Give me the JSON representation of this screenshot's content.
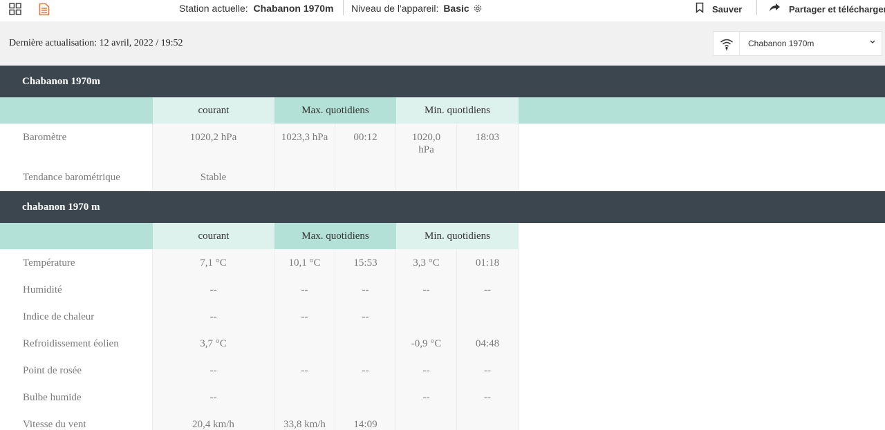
{
  "header": {
    "station_label": "Station actuelle:",
    "station_value": "Chabanon 1970m",
    "level_label": "Niveau de l'appareil:",
    "level_value": "Basic",
    "save_label": "Sauver",
    "share_label": "Partager et télécharger"
  },
  "update": {
    "text": "Dernière actualisation: 12 avril, 2022 / 19:52"
  },
  "selector": {
    "value": "Chabanon 1970m"
  },
  "section1": {
    "title": "Chabanon 1970m",
    "col_current": "courant",
    "col_max": "Max. quotidiens",
    "col_min": "Min. quotidiens",
    "rows": [
      {
        "label": "Baromètre",
        "current": "1020,2 hPa",
        "max": "1023,3 hPa",
        "max_time": "00:12",
        "min": "1020,0 hPa",
        "min_time": "18:03"
      },
      {
        "label": "Tendance barométrique",
        "current": "Stable",
        "max": "",
        "max_time": "",
        "min": "",
        "min_time": ""
      }
    ]
  },
  "section2": {
    "title": "chabanon 1970 m",
    "col_current": "courant",
    "col_max": "Max. quotidiens",
    "col_min": "Min. quotidiens",
    "rows": [
      {
        "label": "Température",
        "current": "7,1 °C",
        "max": "10,1 °C",
        "max_time": "15:53",
        "min": "3,3 °C",
        "min_time": "01:18"
      },
      {
        "label": "Humidité",
        "current": "--",
        "max": "--",
        "max_time": "--",
        "min": "--",
        "min_time": "--"
      },
      {
        "label": "Indice de chaleur",
        "current": "--",
        "max": "--",
        "max_time": "--",
        "min": "",
        "min_time": ""
      },
      {
        "label": "Refroidissement éolien",
        "current": "3,7 °C",
        "max": "",
        "max_time": "",
        "min": "-0,9 °C",
        "min_time": "04:48"
      },
      {
        "label": "Point de rosée",
        "current": "--",
        "max": "--",
        "max_time": "--",
        "min": "--",
        "min_time": "--"
      },
      {
        "label": "Bulbe humide",
        "current": "--",
        "max": "",
        "max_time": "",
        "min": "--",
        "min_time": "--"
      },
      {
        "label": "Vitesse du vent",
        "current": "20,4 km/h",
        "max": "33,8 km/h",
        "max_time": "14:09",
        "min": "",
        "min_time": ""
      }
    ]
  },
  "colors": {
    "section_header_bg": "#3b464e",
    "colhead_teal": "#b4e1d7",
    "colhead_light": "#def2ed",
    "page_bg": "#f1f1f1"
  },
  "icons": [
    "grid-icon",
    "document-icon",
    "gear-icon",
    "bookmark-icon",
    "share-arrow-icon",
    "wifi-signal-icon",
    "chevron-down-icon"
  ]
}
